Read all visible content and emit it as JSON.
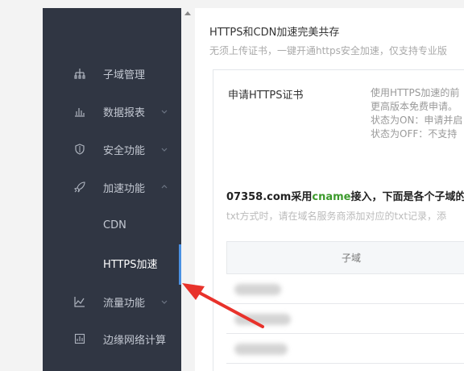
{
  "sidebar": {
    "items": [
      {
        "label": "子域管理",
        "icon": "sitemap-icon",
        "chevron": "none"
      },
      {
        "label": "数据报表",
        "icon": "bar-chart-icon",
        "chevron": "down"
      },
      {
        "label": "安全功能",
        "icon": "shield-icon",
        "chevron": "down"
      },
      {
        "label": "加速功能",
        "icon": "rocket-icon",
        "chevron": "up"
      },
      {
        "label": "CDN",
        "icon": "",
        "chevron": "none"
      },
      {
        "label": "HTTPS加速",
        "icon": "",
        "chevron": "none"
      },
      {
        "label": "流量功能",
        "icon": "line-chart-icon",
        "chevron": "down"
      },
      {
        "label": "边缘网络计算",
        "icon": "calculator-icon",
        "chevron": "none"
      }
    ]
  },
  "main": {
    "title": "HTTPS和CDN加速完美共存",
    "subtitle": "无须上传证书，一键开通https安全加速，仅支持专业版",
    "card": {
      "https_label": "申请HTTPS证书",
      "desc_lines": [
        "使用HTTPS加速的前",
        "更高版本免费申请。",
        "状态为ON：申请并启",
        "状态为OFF：不支持"
      ],
      "cname_prefix": "07358.com采用",
      "cname_word": "cname",
      "cname_suffix": "接入，下面是各个子域的HT",
      "txt_line": "txt方式时，请在域名服务商添加对应的txt记录，添",
      "table_header": "子域"
    }
  },
  "colors": {
    "sidebar_bg": "#303643",
    "accent": "#4a90e2",
    "cname_green": "#3c9a2c",
    "annotation_arrow": "#e8322b"
  }
}
